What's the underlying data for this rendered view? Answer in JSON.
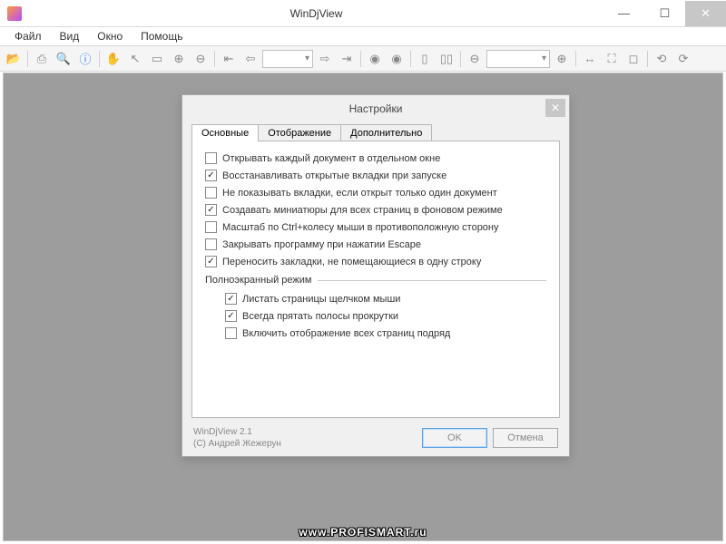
{
  "window": {
    "title": "WinDjView",
    "menu": [
      "Файл",
      "Вид",
      "Окно",
      "Помощь"
    ]
  },
  "dialog": {
    "title": "Настройки",
    "tabs": [
      "Основные",
      "Отображение",
      "Дополнительно"
    ],
    "active_tab": 0,
    "options": [
      {
        "label": "Открывать каждый документ в отдельном окне",
        "checked": false
      },
      {
        "label": "Восстанавливать открытые вкладки при запуске",
        "checked": true
      },
      {
        "label": "Не показывать вкладки, если открыт только один документ",
        "checked": false
      },
      {
        "label": "Создавать миниатюры для всех страниц в фоновом режиме",
        "checked": true
      },
      {
        "label": "Масштаб по Ctrl+колесу мыши в противоположную сторону",
        "checked": false
      },
      {
        "label": "Закрывать программу при нажатии Escape",
        "checked": false
      },
      {
        "label": "Переносить закладки, не помещающиеся в одну строку",
        "checked": true
      }
    ],
    "fullscreen_group": "Полноэкранный режим",
    "fullscreen_options": [
      {
        "label": "Листать страницы щелчком мыши",
        "checked": true
      },
      {
        "label": "Всегда прятать полосы прокрутки",
        "checked": true
      },
      {
        "label": "Включить отображение всех страниц подряд",
        "checked": false
      }
    ],
    "version_line1": "WinDjView 2.1",
    "version_line2": "(C) Андрей Жежерун",
    "ok": "OK",
    "cancel": "Отмена"
  },
  "watermark": "www.PROFISMART.ru"
}
